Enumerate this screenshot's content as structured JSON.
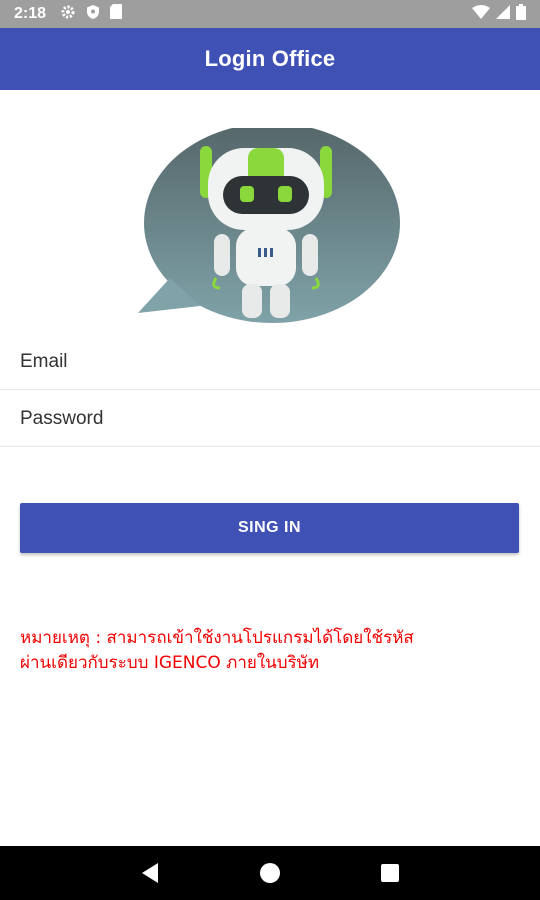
{
  "status_bar": {
    "time": "2:18",
    "icons": [
      "gear-icon",
      "shield-icon",
      "sim-card-icon",
      "wifi-icon",
      "signal-icon",
      "battery-icon"
    ]
  },
  "app_bar": {
    "title": "Login Office"
  },
  "logo": {
    "icon": "robot-chat-icon"
  },
  "form": {
    "email_placeholder": "Email",
    "email_value": "",
    "password_placeholder": "Password",
    "password_value": "",
    "signin_label": "SING IN"
  },
  "note": {
    "line1": "หมายเหตุ : สามารถเข้าใช้งานโปรแกรมได้โดยใช้รหัส",
    "line2": "ผ่านเดียวกับระบบ IGENCO ภายในบริษัท"
  },
  "nav_bar": {
    "icons": [
      "back-icon",
      "home-icon",
      "recents-icon"
    ]
  },
  "colors": {
    "primary": "#3f51b5",
    "note_text": "#f00000",
    "status_bar": "#9e9e9e"
  }
}
